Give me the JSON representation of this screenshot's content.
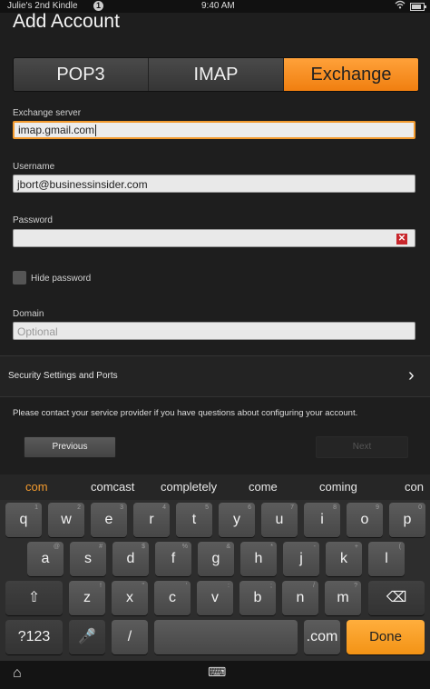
{
  "status": {
    "device": "Julie's 2nd Kindle",
    "badge": "1",
    "time": "9:40 AM",
    "battery_fraction": 0.8
  },
  "title": "Add Account",
  "tabs": [
    {
      "label": "POP3"
    },
    {
      "label": "IMAP"
    },
    {
      "label": "Exchange"
    }
  ],
  "form": {
    "server_label": "Exchange server",
    "server_value": "imap.gmail.com",
    "username_label": "Username",
    "username_value": "jbort@businessinsider.com",
    "password_label": "Password",
    "password_value": "",
    "hide_password_label": "Hide password",
    "domain_label": "Domain",
    "domain_placeholder": "Optional",
    "clear_glyph": "✕"
  },
  "security": {
    "label": "Security Settings and Ports",
    "chevron": "›"
  },
  "note": "Please contact your service provider if you have questions about configuring your account.",
  "buttons": {
    "previous": "Previous",
    "next": "Next"
  },
  "keyboard": {
    "suggestions": [
      "com",
      "comcast",
      "completely",
      "come",
      "coming",
      "con"
    ],
    "row1": [
      {
        "k": "q",
        "a": "1"
      },
      {
        "k": "w",
        "a": "2"
      },
      {
        "k": "e",
        "a": "3"
      },
      {
        "k": "r",
        "a": "4"
      },
      {
        "k": "t",
        "a": "5"
      },
      {
        "k": "y",
        "a": "6"
      },
      {
        "k": "u",
        "a": "7"
      },
      {
        "k": "i",
        "a": "8"
      },
      {
        "k": "o",
        "a": "9"
      },
      {
        "k": "p",
        "a": "0"
      }
    ],
    "row2": [
      {
        "k": "a",
        "a": "@"
      },
      {
        "k": "s",
        "a": "#"
      },
      {
        "k": "d",
        "a": "$"
      },
      {
        "k": "f",
        "a": "%"
      },
      {
        "k": "g",
        "a": "&"
      },
      {
        "k": "h",
        "a": "*"
      },
      {
        "k": "j",
        "a": "-"
      },
      {
        "k": "k",
        "a": "+"
      },
      {
        "k": "l",
        "a": "("
      }
    ],
    "row3": [
      {
        "k": "z",
        "a": "!"
      },
      {
        "k": "x",
        "a": "\""
      },
      {
        "k": "c",
        "a": "'"
      },
      {
        "k": "v",
        "a": ":"
      },
      {
        "k": "b",
        "a": ";"
      },
      {
        "k": "n",
        "a": "/"
      },
      {
        "k": "m",
        "a": "?"
      }
    ],
    "shift_glyph": "⇧",
    "backspace_glyph": "⌫",
    "sym": "?123",
    "mic_glyph": "🎤",
    "slash": "/",
    "dotcom": ".com",
    "done": "Done"
  },
  "nav": {
    "home_glyph": "⌂",
    "keyboard_glyph": "⌨"
  }
}
